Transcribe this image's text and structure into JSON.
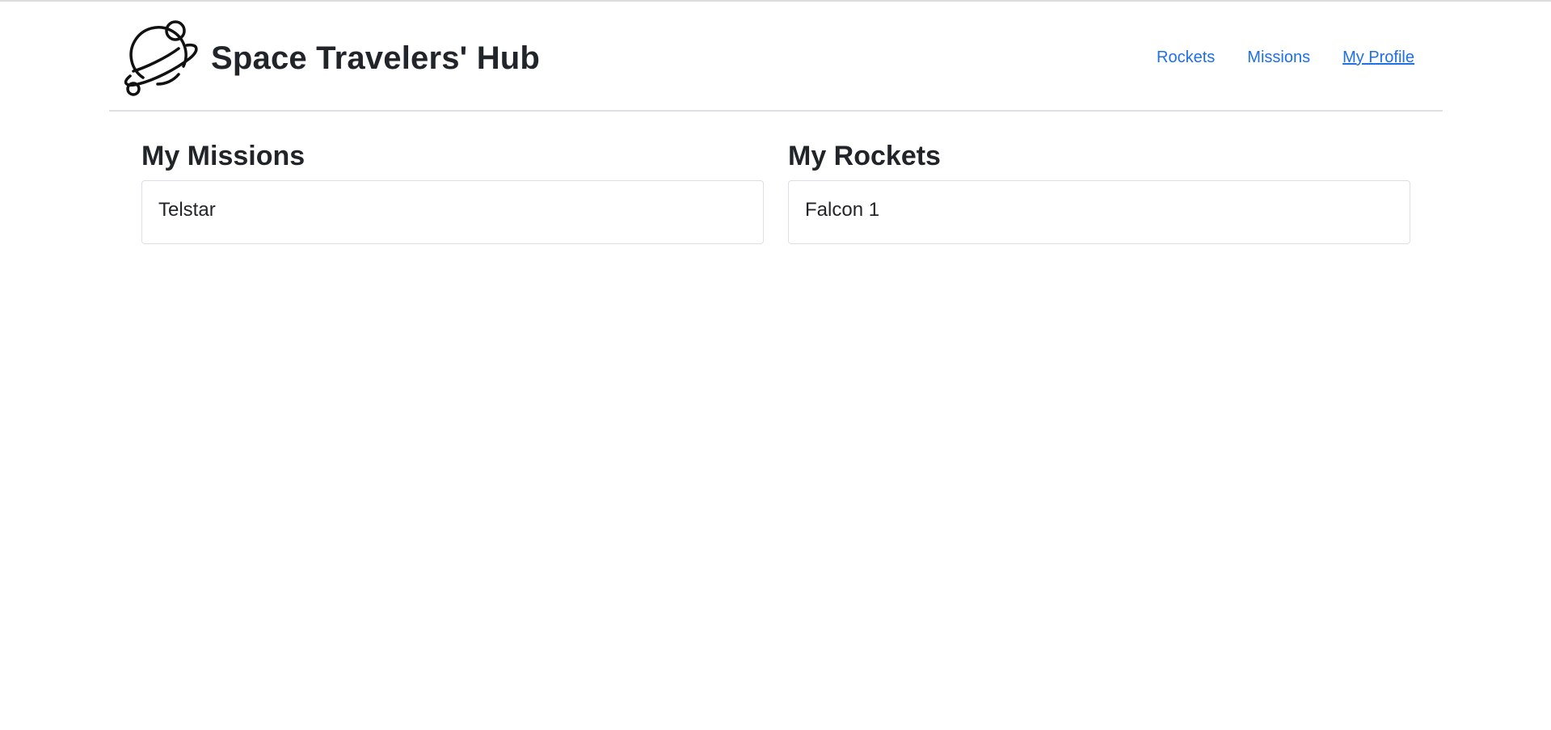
{
  "header": {
    "title": "Space Travelers' Hub",
    "logo_icon": "planet-logo-icon",
    "nav": [
      {
        "label": "Rockets",
        "active": false
      },
      {
        "label": "Missions",
        "active": false
      },
      {
        "label": "My Profile",
        "active": true
      }
    ],
    "link_color": "#1f6fe5"
  },
  "profile": {
    "missions": {
      "heading": "My Missions",
      "items": [
        "Telstar"
      ]
    },
    "rockets": {
      "heading": "My Rockets",
      "items": [
        "Falcon 1"
      ]
    }
  }
}
